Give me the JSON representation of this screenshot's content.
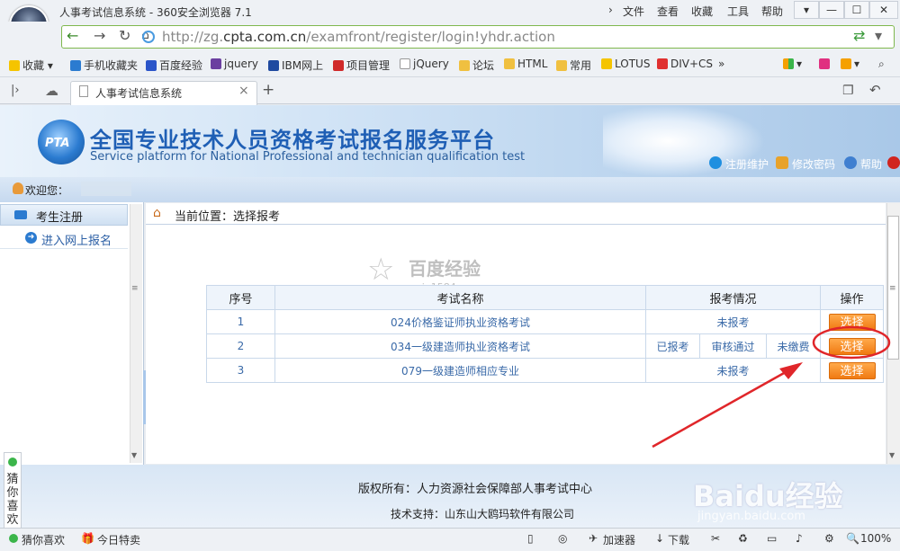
{
  "browser": {
    "window_title": "人事考试信息系统 - 360安全浏览器 7.1",
    "menu": [
      "文件",
      "查看",
      "收藏",
      "工具",
      "帮助"
    ],
    "window_buttons": [
      "▾",
      "—",
      "☐",
      "✕"
    ],
    "url_prefix": "http://zg.",
    "url_domain": "cpta.com.cn",
    "url_path": "/examfront/register/login!yhdr.action",
    "bookmarks": [
      "收藏",
      "手机收藏夹",
      "百度经验",
      "jquery",
      "IBM网上",
      "项目管理",
      "jQuery",
      "论坛",
      "HTML",
      "常用",
      "LOTUS",
      "DIV+CS"
    ],
    "bookmarks_more": "»",
    "tab_title": "人事考试信息系统",
    "tab_close": "×",
    "new_tab": "+"
  },
  "header": {
    "logo_text": "PTA",
    "title": "全国专业技术人员资格考试报名服务平台",
    "subtitle": "Service platform for National Professional and technician qualification test",
    "links": [
      "注册维护",
      "修改密码",
      "帮助"
    ]
  },
  "welcome": "欢迎您：",
  "sidebar": {
    "section": "考生注册",
    "item": "进入网上报名"
  },
  "breadcrumb": "当前位置：选择报考",
  "table": {
    "headers": [
      "序号",
      "考试名称",
      "报考情况",
      "操作"
    ],
    "rows": [
      {
        "no": "1",
        "name": "024价格鉴证师执业资格考试",
        "status": [
          "未报考"
        ],
        "action": "选择"
      },
      {
        "no": "2",
        "name": "034一级建造师执业资格考试",
        "status": [
          "已报考",
          "审核通过",
          "未缴费"
        ],
        "action": "选择"
      },
      {
        "no": "3",
        "name": "079一级建造师相应专业",
        "status": [
          "未报考"
        ],
        "action": "选择"
      }
    ]
  },
  "watermark": {
    "main": "百度经验",
    "user": "min1584",
    "logo": "Baidu经验",
    "site": "jingyan.baidu.com"
  },
  "footer": {
    "copyright": "版权所有：人力资源社会保障部人事考试中心",
    "support": "技术支持：山东山大鸥玛软件有限公司"
  },
  "side_widget": "猜你喜欢",
  "statusbar": {
    "left": [
      "猜你喜欢",
      "今日特卖"
    ],
    "right": [
      "加速器",
      "下载"
    ],
    "zoom": "100%"
  },
  "colors": {
    "accent": "#1f5fb5",
    "button": "#f07a12",
    "annotation": "#e0262a"
  }
}
